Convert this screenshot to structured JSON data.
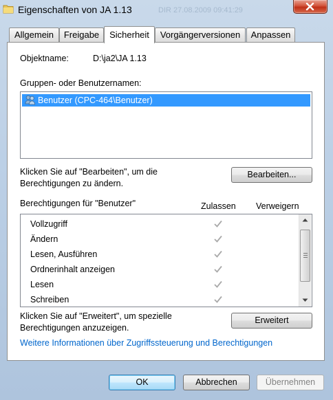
{
  "window": {
    "title": "Eigenschaften von JA 1.13",
    "background_ghost_text": "DIR   27.08.2009   09:41:29"
  },
  "tabs": [
    {
      "label": "Allgemein"
    },
    {
      "label": "Freigabe"
    },
    {
      "label": "Sicherheit",
      "active": true
    },
    {
      "label": "Vorgängerversionen"
    },
    {
      "label": "Anpassen"
    }
  ],
  "security": {
    "object_label": "Objektname:",
    "object_value": "D:\\ja2\\JA 1.13",
    "groups_label": "Gruppen- oder Benutzernamen:",
    "groups": [
      {
        "name": "Benutzer (CPC-464\\Benutzer)",
        "selected": true,
        "icon": "users-icon"
      }
    ],
    "edit_hint_line1": "Klicken Sie auf \"Bearbeiten\", um die",
    "edit_hint_line2": "Berechtigungen zu ändern.",
    "edit_button": "Bearbeiten...",
    "perm_header": "Berechtigungen für \"Benutzer\"",
    "col_allow": "Zulassen",
    "col_deny": "Verweigern",
    "permissions": [
      {
        "name": "Vollzugriff",
        "allow": true,
        "deny": false
      },
      {
        "name": "Ändern",
        "allow": true,
        "deny": false
      },
      {
        "name": "Lesen, Ausführen",
        "allow": true,
        "deny": false
      },
      {
        "name": "Ordnerinhalt anzeigen",
        "allow": true,
        "deny": false
      },
      {
        "name": "Lesen",
        "allow": true,
        "deny": false
      },
      {
        "name": "Schreiben",
        "allow": true,
        "deny": false
      }
    ],
    "advanced_hint_line1": "Klicken Sie auf \"Erweitert\", um spezielle",
    "advanced_hint_line2": "Berechtigungen anzuzeigen.",
    "advanced_button": "Erweitert",
    "info_link": "Weitere Informationen über Zugriffssteuerung und Berechtigungen"
  },
  "footer": {
    "ok": "OK",
    "cancel": "Abbrechen",
    "apply": "Übernehmen"
  },
  "colors": {
    "selection": "#3399ff",
    "link": "#0066cc",
    "check": "#a9a9a9"
  }
}
